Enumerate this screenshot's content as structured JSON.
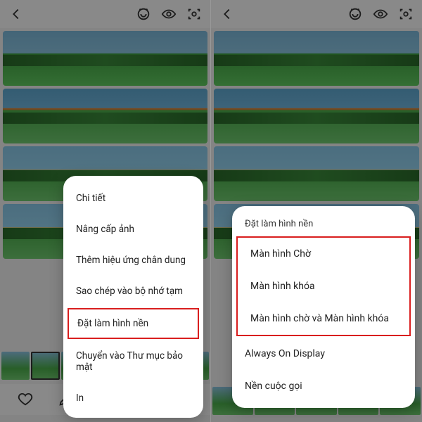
{
  "left": {
    "menu": {
      "items": [
        "Chi tiết",
        "Nâng cấp ảnh",
        "Thêm hiệu ứng chân dung",
        "Sao chép vào bộ nhớ tạm"
      ],
      "highlighted": "Đặt làm hình nền",
      "after": [
        "Chuyển vào Thư mục bảo mật",
        "In"
      ]
    }
  },
  "right": {
    "menu": {
      "title": "Đặt làm hình nền",
      "highlighted": [
        "Màn hình Chờ",
        "Màn hình khóa",
        "Màn hình chờ và Màn hình khóa"
      ],
      "after": [
        "Always On Display",
        "Nền cuộc gọi"
      ]
    }
  }
}
